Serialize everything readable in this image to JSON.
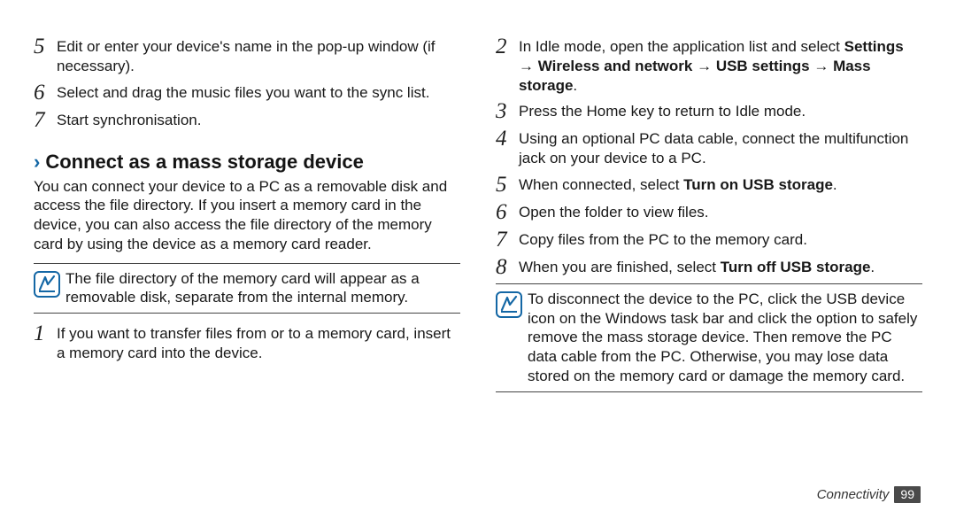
{
  "left": {
    "steps_a": [
      {
        "num": "5",
        "html": "Edit or enter your device's name in the pop-up window (if necessary)."
      },
      {
        "num": "6",
        "html": "Select and drag the music files you want to the sync list."
      },
      {
        "num": "7",
        "html": "Start synchronisation."
      }
    ],
    "section": {
      "chevron": "›",
      "title": "Connect as a mass storage device",
      "desc": "You can connect your device to a PC as a removable disk and access the file directory. If you insert a memory card in the device, you can also access the file directory of the memory card by using the device as a memory card reader."
    },
    "note": "The file directory of the memory card will appear as a removable disk, separate from the internal memory.",
    "steps_b": [
      {
        "num": "1",
        "html": "If you want to transfer files from or to a memory card, insert a memory card into the device."
      }
    ]
  },
  "right": {
    "steps": [
      {
        "num": "2",
        "html": "In Idle mode, open the application list and select <span class=\"bold\">Settings</span> → <span class=\"bold\">Wireless and network</span> → <span class=\"bold\">USB settings</span> → <span class=\"bold\">Mass storage</span>."
      },
      {
        "num": "3",
        "html": "Press the Home key to return to Idle mode."
      },
      {
        "num": "4",
        "html": "Using an optional PC data cable, connect the multifunction jack on your device to a PC."
      },
      {
        "num": "5",
        "html": "When connected, select <span class=\"bold\">Turn on USB storage</span>."
      },
      {
        "num": "6",
        "html": "Open the folder to view files."
      },
      {
        "num": "7",
        "html": "Copy files from the PC to the memory card."
      },
      {
        "num": "8",
        "html": "When you are finished, select <span class=\"bold\">Turn off USB storage</span>."
      }
    ],
    "note": "To disconnect the device to the PC, click the USB device icon on the Windows task bar and click the option to safely remove the mass storage device. Then remove the PC data cable from the PC. Otherwise, you may lose data stored on the memory card or damage the memory card."
  },
  "footer": {
    "section": "Connectivity",
    "page": "99"
  }
}
